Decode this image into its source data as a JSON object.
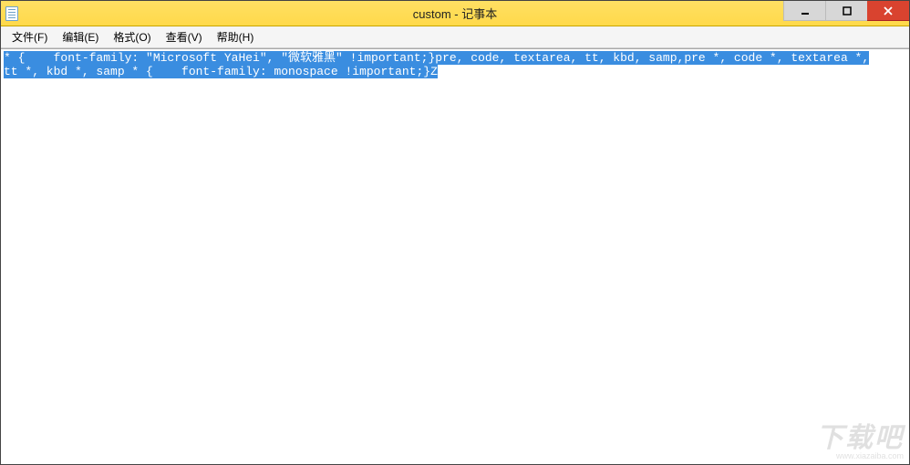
{
  "window": {
    "title": "custom - 记事本"
  },
  "menu": {
    "file": "文件(F)",
    "edit": "编辑(E)",
    "format": "格式(O)",
    "view": "查看(V)",
    "help": "帮助(H)"
  },
  "editor": {
    "line1": "* {    font-family: \"Microsoft YaHei\", \"微软雅黑\" !important;}pre, code, textarea, tt, kbd, samp,pre *, code *, textarea *,",
    "line2": "tt *, kbd *, samp * {    font-family: monospace !important;}Z"
  },
  "watermark": {
    "big": "下载吧",
    "small": "www.xiazaiba.com"
  },
  "colors": {
    "titlebar": "#ffd94a",
    "selection": "#3a8de0",
    "close": "#d9432f"
  }
}
